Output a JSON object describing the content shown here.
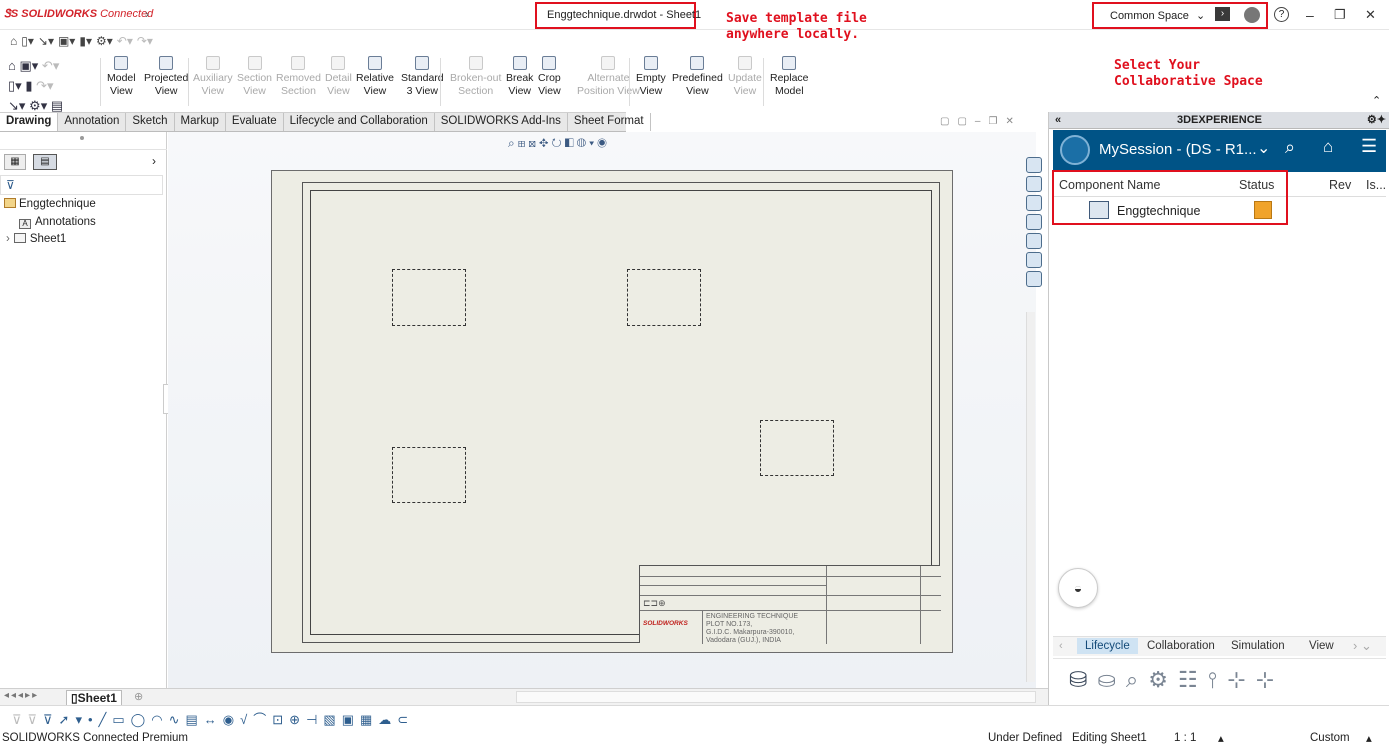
{
  "app": {
    "logo_brand": "SOLIDWORKS",
    "logo_suffix": "Connected",
    "doc_title": "Enggtechnique.drwdot - Sheet1"
  },
  "annotations": {
    "save_template": "Save template file anywhere locally.",
    "collab_space": "Select Your Collaborative Space"
  },
  "header_right": {
    "space_select": "Common Space",
    "help": "?",
    "minimize": "–",
    "restore": "❐",
    "close": "✕"
  },
  "ribbon": {
    "buttons": [
      {
        "l1": "Model",
        "l2": "View",
        "enabled": true
      },
      {
        "l1": "Projected",
        "l2": "View",
        "enabled": true
      },
      {
        "l1": "Auxiliary",
        "l2": "View",
        "enabled": false
      },
      {
        "l1": "Section",
        "l2": "View",
        "enabled": false
      },
      {
        "l1": "Removed",
        "l2": "Section",
        "enabled": false
      },
      {
        "l1": "Detail",
        "l2": "View",
        "enabled": false
      },
      {
        "l1": "Relative",
        "l2": "View",
        "enabled": true
      },
      {
        "l1": "Standard",
        "l2": "3 View",
        "enabled": true
      },
      {
        "l1": "Broken-out",
        "l2": "Section",
        "enabled": false
      },
      {
        "l1": "Break",
        "l2": "View",
        "enabled": true
      },
      {
        "l1": "Crop",
        "l2": "View",
        "enabled": true
      },
      {
        "l1": "Alternate",
        "l2": "Position View",
        "enabled": false
      },
      {
        "l1": "Empty",
        "l2": "View",
        "enabled": true
      },
      {
        "l1": "Predefined",
        "l2": "View",
        "enabled": true
      },
      {
        "l1": "Update",
        "l2": "View",
        "enabled": false
      },
      {
        "l1": "Replace",
        "l2": "Model",
        "enabled": true
      }
    ]
  },
  "tabs": [
    "Drawing",
    "Annotation",
    "Sketch",
    "Markup",
    "Evaluate",
    "Lifecycle and Collaboration",
    "SOLIDWORKS Add-Ins",
    "Sheet Format"
  ],
  "tree": {
    "root": "Enggtechnique",
    "annotations": "Annotations",
    "sheet": "Sheet1"
  },
  "title_block": {
    "company": "ENGINEERING TECHNIQUE",
    "addr1": "PLOT NO.173,",
    "addr2": "G.I.D.C. Makarpura-390010,",
    "addr3": "Vadodara (GUJ.), INDIA",
    "sw_logo": "SOLIDWORKS"
  },
  "right_panel": {
    "header": "3DEXPERIENCE",
    "session": "MySession - (DS - R1...",
    "col_name": "Component Name",
    "col_status": "Status",
    "col_rev": "Rev",
    "col_is": "Is...",
    "row_name": "Enggtechnique",
    "bottom_tabs": [
      "Lifecycle",
      "Collaboration",
      "Simulation",
      "View"
    ]
  },
  "sheet_tab": "Sheet1",
  "status": {
    "left": "SOLIDWORKS Connected Premium",
    "state": "Under Defined",
    "editing": "Editing Sheet1",
    "scale": "1 : 1",
    "units": "Custom"
  },
  "colors": {
    "accent_red": "#e0101e",
    "panel_blue": "#005386",
    "sheet_bg": "#edede4"
  }
}
